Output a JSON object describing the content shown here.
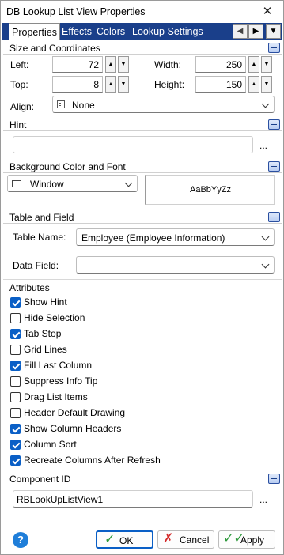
{
  "window": {
    "title": "DB Lookup List View Properties"
  },
  "tabs": [
    "Properties",
    "Effects",
    "Colors",
    "Lookup Settings"
  ],
  "size": {
    "header": "Size and Coordinates",
    "left_label": "Left:",
    "left_value": "72",
    "top_label": "Top:",
    "top_value": "8",
    "width_label": "Width:",
    "width_value": "250",
    "height_label": "Height:",
    "height_value": "150",
    "align_label": "Align:",
    "align_value": "None"
  },
  "hint": {
    "header": "Hint",
    "value": "",
    "ellipsis": "..."
  },
  "background": {
    "header": "Background Color and Font",
    "color_value": "Window",
    "preview_text": "AaBbYyZz"
  },
  "table_field": {
    "header": "Table and Field",
    "table_label": "Table Name:",
    "table_value": "Employee  (Employee Information)",
    "field_label": "Data Field:",
    "field_value": ""
  },
  "attributes": {
    "header": "Attributes",
    "items": [
      {
        "label": "Show Hint",
        "checked": true
      },
      {
        "label": "Hide Selection",
        "checked": false
      },
      {
        "label": "Tab Stop",
        "checked": true
      },
      {
        "label": "Grid Lines",
        "checked": false
      },
      {
        "label": "Fill Last Column",
        "checked": true
      },
      {
        "label": "Suppress Info Tip",
        "checked": false
      },
      {
        "label": "Drag List Items",
        "checked": false
      },
      {
        "label": "Header Default Drawing",
        "checked": false
      },
      {
        "label": "Show Column Headers",
        "checked": true
      },
      {
        "label": "Column Sort",
        "checked": true
      },
      {
        "label": "Recreate Columns After Refresh",
        "checked": true
      }
    ]
  },
  "component": {
    "header": "Component ID",
    "value": "RBLookUpListView1",
    "ellipsis": "..."
  },
  "buttons": {
    "ok": "OK",
    "cancel": "Cancel",
    "apply": "Apply"
  },
  "colors": {
    "accent": "#0a5fc6",
    "tabstrip": "#1a3f8a",
    "help": "#1f7ed9",
    "cancel_x": "#d42a2a",
    "apply_check": "#2e9a3c"
  }
}
